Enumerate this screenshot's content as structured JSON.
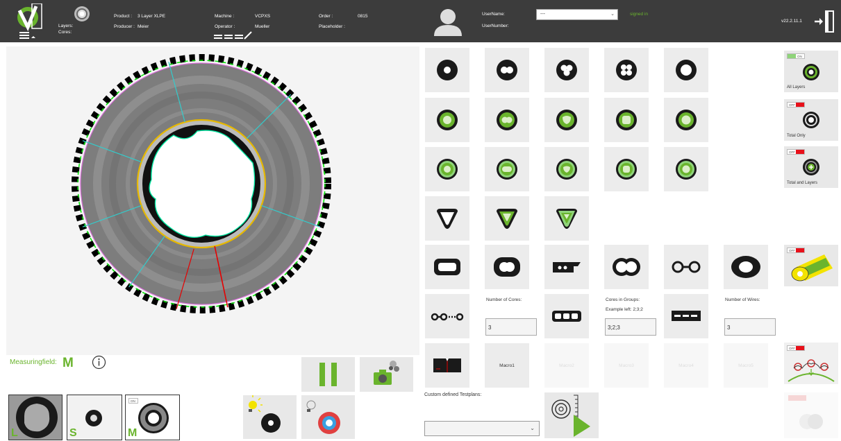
{
  "header": {
    "layers_label": "Layers:",
    "cores_label": "Cores:",
    "product_label": "Product :",
    "product_value": "3 Layer XLPE",
    "producer_label": "Producer :",
    "producer_value": "Meier",
    "machine_label": "Machine :",
    "machine_value": "VCPXS",
    "operator_label": "Operator :",
    "operator_value": "Mueller",
    "order_label": "Order :",
    "order_value": "0815",
    "placeholder_label": "Placeholder :",
    "username_label": "UserName:",
    "usernumber_label": "UserNumber:",
    "user_select_value": "---",
    "signed_in": "signed in",
    "version": "v22.2.11.1"
  },
  "toggles": {
    "all_layers": {
      "state": "ON",
      "caption": "All Layers"
    },
    "total_only": {
      "state": "OFF",
      "caption": "Total Only"
    },
    "total_and_layers": {
      "state": "OFF",
      "caption": "Total and Layers"
    },
    "wire_toggle": {
      "state": "OFF"
    },
    "curve_toggle": {
      "state": "OFF"
    }
  },
  "forms": {
    "number_of_cores_label": "Number of Cores:",
    "number_of_cores_value": "3",
    "cores_in_groups_label": "Cores in Groups:",
    "cores_in_groups_example": "Example left: 2;3;2",
    "cores_in_groups_value": "3;2;3",
    "number_of_wires_label": "Number of Wires:",
    "number_of_wires_value": "3"
  },
  "macros": [
    "Macro1",
    "Macro2",
    "Macro3",
    "Macro4",
    "Macro5"
  ],
  "measuringfield": {
    "label": "Measuringfield:",
    "value": "M"
  },
  "thumbnails": [
    {
      "letter": "L"
    },
    {
      "letter": "S"
    },
    {
      "letter": "M",
      "badge": "ON"
    }
  ],
  "testplans": {
    "label": "Custom defined Testplans:",
    "selected": ""
  },
  "colors": {
    "header_bg": "#3c3c3c",
    "accent_green": "#6ab42d",
    "off_red": "#e8101a",
    "on_green": "#8fd47a"
  },
  "icons": [
    "logo-icon",
    "menu-icon",
    "layers-icon",
    "separator-line-icon",
    "user-avatar-icon",
    "exit-icon",
    "info-icon",
    "pause-icon",
    "camera-icon",
    "light-on-icon",
    "light-off-icon",
    "testplan-run-icon"
  ]
}
